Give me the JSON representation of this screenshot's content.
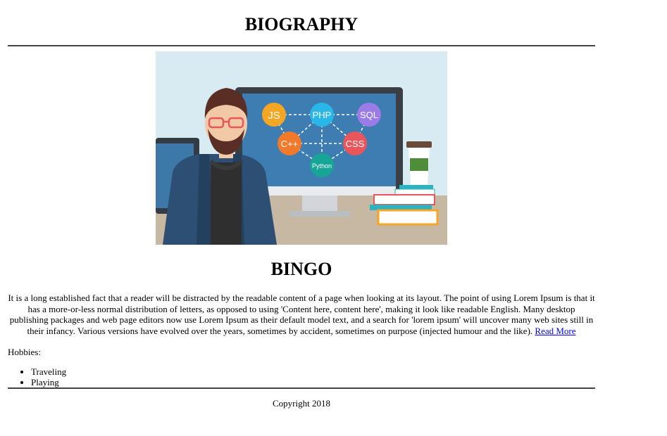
{
  "header": {
    "title": "BIOGRAPHY"
  },
  "hero": {
    "badges": [
      {
        "label": "JS",
        "color": "#f5a623"
      },
      {
        "label": "PHP",
        "color": "#29b6e8"
      },
      {
        "label": "SQL",
        "color": "#9b7be8"
      },
      {
        "label": "C++",
        "color": "#f07a2a"
      },
      {
        "label": "CSS",
        "color": "#e8555b"
      },
      {
        "label": "Python",
        "color": "#16a596"
      }
    ]
  },
  "profile": {
    "name": "BINGO",
    "bio": "It is a long established fact that a reader will be distracted by the readable content of a page when looking at its layout. The point of using Lorem Ipsum is that it has a more-or-less normal distribution of letters, as opposed to using 'Content here, content here', making it look like readable English. Many desktop publishing packages and web page editors now use Lorem Ipsum as their default model text, and a search for 'lorem ipsum' will uncover many web sites still in their infancy. Various versions have evolved over the years, sometimes by accident, sometimes on purpose (injected humour and the like).",
    "read_more": "Read More",
    "hobbies_label": "Hobbies:",
    "hobbies": [
      "Traveling",
      "Playing"
    ]
  },
  "footer": {
    "copyright": "Copyright 2018"
  }
}
